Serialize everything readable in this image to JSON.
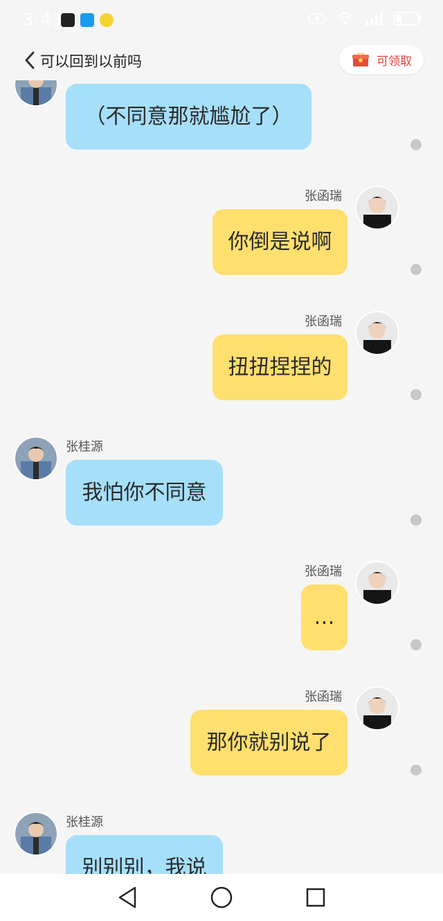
{
  "status_bar": {
    "time": "3:43"
  },
  "header": {
    "back_label": "可以回到以前吗",
    "reward_label": "可领取"
  },
  "messages": [
    {
      "side": "left",
      "name": "",
      "text": "（不同意那就尴尬了）"
    },
    {
      "side": "right",
      "name": "张函瑞",
      "text": "你倒是说啊"
    },
    {
      "side": "right",
      "name": "张函瑞",
      "text": "扭扭捏捏的"
    },
    {
      "side": "left",
      "name": "张桂源",
      "text": "我怕你不同意"
    },
    {
      "side": "right",
      "name": "张函瑞",
      "text": "…"
    },
    {
      "side": "right",
      "name": "张函瑞",
      "text": "那你就别说了"
    },
    {
      "side": "left",
      "name": "张桂源",
      "text": "别别别，我说"
    }
  ],
  "colors": {
    "left_bubble": "#a6dffa",
    "right_bubble": "#ffdf6e",
    "reward_text": "#e0473d"
  }
}
